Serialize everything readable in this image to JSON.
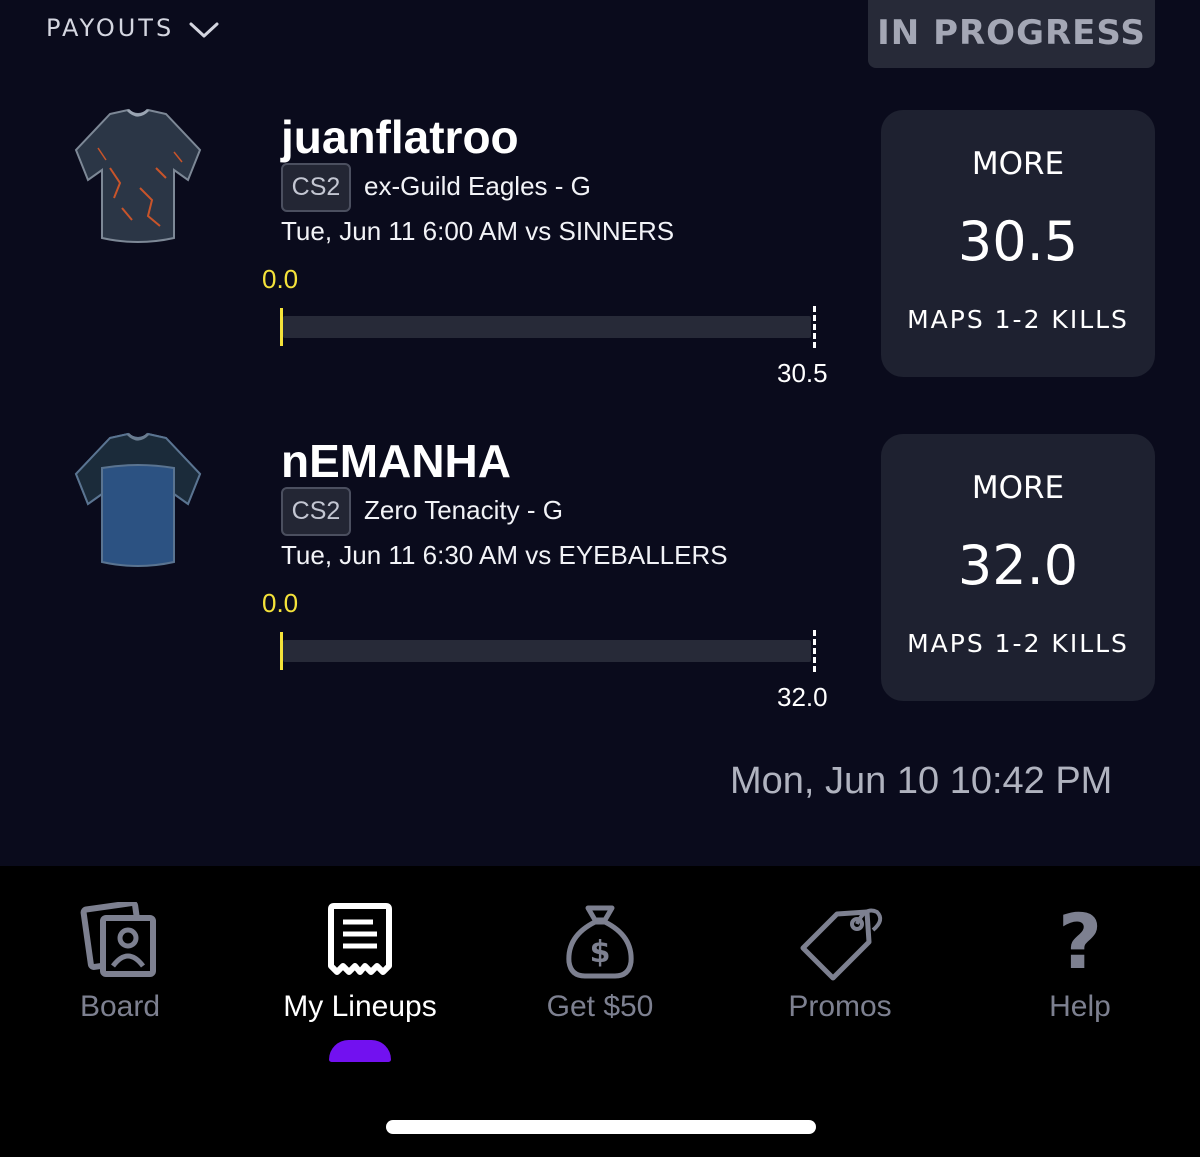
{
  "header": {
    "payouts_label": "PAYOUTS",
    "status_label": "IN PROGRESS"
  },
  "picks": [
    {
      "player": "juanflatroo",
      "game_tag": "CS2",
      "team_position": "ex-Guild Eagles - G",
      "matchup": "Tue, Jun 11 6:00 AM  vs SINNERS",
      "current_value": "0.0",
      "line_value": "30.5",
      "progress": 0.0,
      "direction": "MORE",
      "projection": "30.5",
      "stat": "MAPS 1-2 KILLS",
      "jersey_colors": {
        "body": "#2b3646",
        "accent": "#c8542a"
      }
    },
    {
      "player": "nEMANHA",
      "game_tag": "CS2",
      "team_position": "Zero Tenacity - G",
      "matchup": "Tue, Jun 11 6:30 AM  vs EYEBALLERS",
      "current_value": "0.0",
      "line_value": "32.0",
      "progress": 0.0,
      "direction": "MORE",
      "projection": "32.0",
      "stat": "MAPS 1-2 KILLS",
      "jersey_colors": {
        "body": "#2c5282",
        "accent": "#1b2b3a"
      }
    }
  ],
  "lineup_date": "Mon, Jun 10 10:42 PM",
  "tabs": [
    {
      "label": "Board",
      "icon": "board-icon",
      "active": false
    },
    {
      "label": "My Lineups",
      "icon": "lineups-icon",
      "active": true
    },
    {
      "label": "Get $50",
      "icon": "money-bag-icon",
      "active": false
    },
    {
      "label": "Promos",
      "icon": "tag-icon",
      "active": false
    },
    {
      "label": "Help",
      "icon": "question-icon",
      "active": false
    }
  ],
  "colors": {
    "accent": "#7211f0",
    "progress": "#f4e23a",
    "background": "#0a0b1c",
    "card": "#1e2130"
  }
}
